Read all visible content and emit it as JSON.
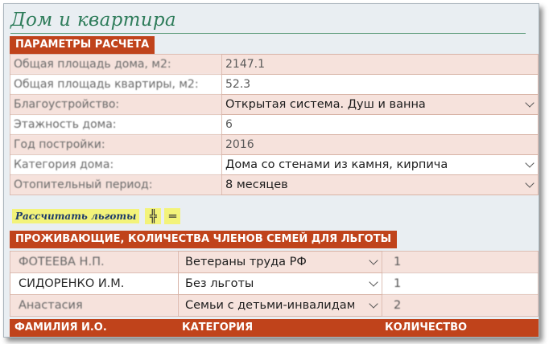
{
  "title": "Дом и квартира",
  "params": {
    "header": "ПАРАМЕТРЫ РАСЧЕТА",
    "rows": [
      {
        "label": "Общая площадь дома, м2:",
        "value": "2147.1"
      },
      {
        "label": "Общая площадь квартиры, м2:",
        "value": "52.3"
      },
      {
        "label": "Благоустройство:",
        "value": "Открытая система. Душ и ванна"
      },
      {
        "label": "Этажность дома:",
        "value": "6"
      },
      {
        "label": "Год постройки:",
        "value": "2016"
      },
      {
        "label": "Категория дома:",
        "value": "Дома со стенами из камня, кирпича"
      },
      {
        "label": "Отопительный период:",
        "value": "8 месяцев"
      }
    ]
  },
  "actions": {
    "calculate_label": "Рассчитать льготы",
    "icon1": "╬",
    "icon2": "═"
  },
  "residents": {
    "header": "ПРОЖИВАЮЩИЕ, КОЛИЧЕСТВА ЧЛЕНОВ СЕМЕЙ ДЛЯ ЛЬГОТЫ",
    "rows": [
      {
        "name": "ФОТЕЕВА Н.П.",
        "category": "Ветераны труда РФ",
        "count": "1"
      },
      {
        "name": "СИДОРЕНКО И.М.",
        "category": "Без льготы",
        "count": "1"
      },
      {
        "name": "Анастасия",
        "category": "Семьи с детьми-инвалидами",
        "count": "2"
      }
    ],
    "columns": [
      "ФАМИЛИЯ И.О.",
      "КАТЕГОРИЯ",
      "КОЛИЧЕСТВО"
    ]
  },
  "colors": {
    "accent": "#c0431b",
    "title": "#2f7d5b",
    "row_pink": "#f6e2dc",
    "button": "#f3f37a"
  }
}
